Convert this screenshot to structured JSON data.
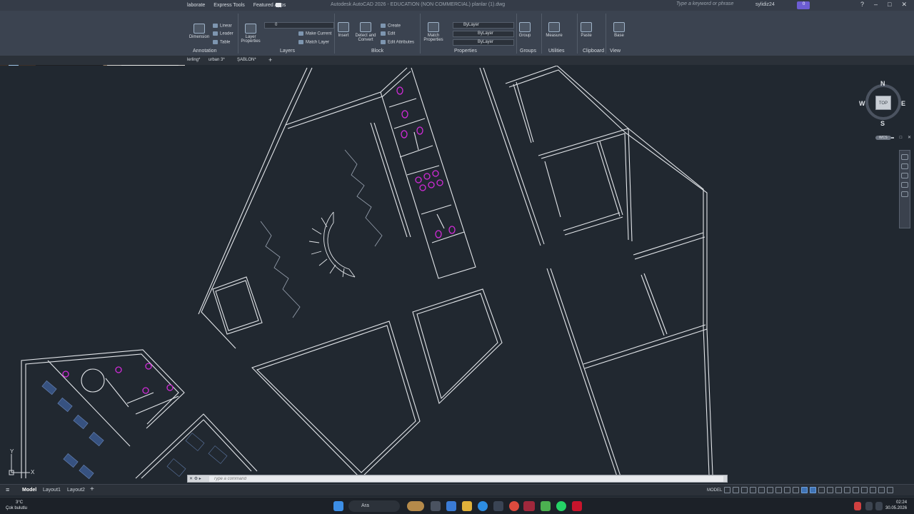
{
  "titlebar": {
    "tabs": [
      "laborate",
      "Express Tools",
      "Featured Apps"
    ],
    "title": "Autodesk AutoCAD 2026 - EDUCATION (NON COMMERCIAL)   planlar (1).dwg",
    "search_placeholder": "Type a keyword or phrase",
    "user": "sylidiz24",
    "share_count": "0"
  },
  "ribbon": {
    "annotation": {
      "dimension": "Dimension",
      "linear": "Linear",
      "leader": "Leader",
      "table": "Table",
      "title": "Annotation"
    },
    "layers": {
      "layer_properties": "Layer Properties",
      "layer_value": "0",
      "make_current": "Make Current",
      "match_layer": "Match Layer",
      "title": "Layers"
    },
    "block": {
      "insert": "Insert",
      "detect": "Detect and Convert",
      "create": "Create",
      "edit": "Edit",
      "edit_attributes": "Edit Attributes",
      "title": "Block"
    },
    "properties": {
      "match_properties": "Match Properties",
      "color": "ByLayer",
      "linetype": "ByLayer",
      "lineweight": "ByLayer",
      "title": "Properties"
    },
    "groups": {
      "group": "Group",
      "title": "Groups"
    },
    "utilities": {
      "measure": "Measure",
      "title": "Utilities"
    },
    "clipboard": {
      "paste": "Paste",
      "title": "Clipboard"
    },
    "view": {
      "base": "Base",
      "title": "View"
    }
  },
  "filetabs": [
    "lerling*",
    "urban 3*",
    "ŞABLON*"
  ],
  "viewcube": {
    "top": "TOP",
    "n": "N",
    "s": "S",
    "e": "E",
    "w": "W",
    "wcs": "WCS"
  },
  "ucs": {
    "x": "X",
    "y": "Y"
  },
  "cmdline": {
    "placeholder": "Type a command"
  },
  "layouts": [
    "Model",
    "Layout1",
    "Layout2"
  ],
  "status": {
    "model": "MODEL"
  },
  "taskbar": {
    "weather_temp": "3°C",
    "weather_desc": "Çok bulutlu",
    "search": "Ara",
    "time": "02:24",
    "date": "30.05.2026"
  }
}
